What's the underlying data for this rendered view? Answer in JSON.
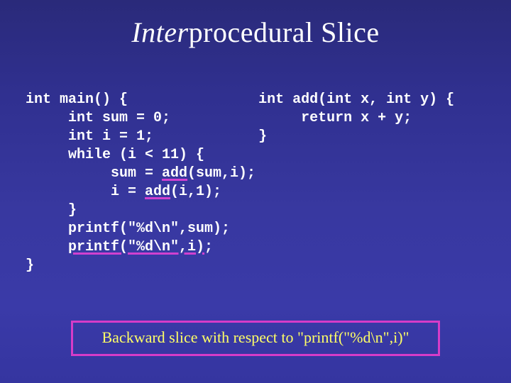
{
  "title_prefix": "Inter",
  "title_rest": "procedural Slice",
  "code_main": {
    "l1": "int main() {",
    "l2": "     int sum = 0;",
    "l3": "     int i = 1;",
    "l4": "     while (i < 11) {",
    "l5a": "          sum = ",
    "l5_add": "add",
    "l5b": "(sum,i);",
    "l6a": "          i = ",
    "l6_add": "add",
    "l6b": "(i,1);",
    "l7": "     }",
    "l8": "     printf(\"%d\\n\",sum);",
    "l9a": "     ",
    "l9_pr": "printf(\"%d\\n\",i)",
    "l9b": ";",
    "l10": "}"
  },
  "code_add": {
    "l1": "int add(int x, int y) {",
    "l2": "     return x + y;",
    "l3": "}"
  },
  "caption_prefix": "Backward slice",
  "caption_rest": " with respect to \"printf(\"%d\\n\",i)\""
}
